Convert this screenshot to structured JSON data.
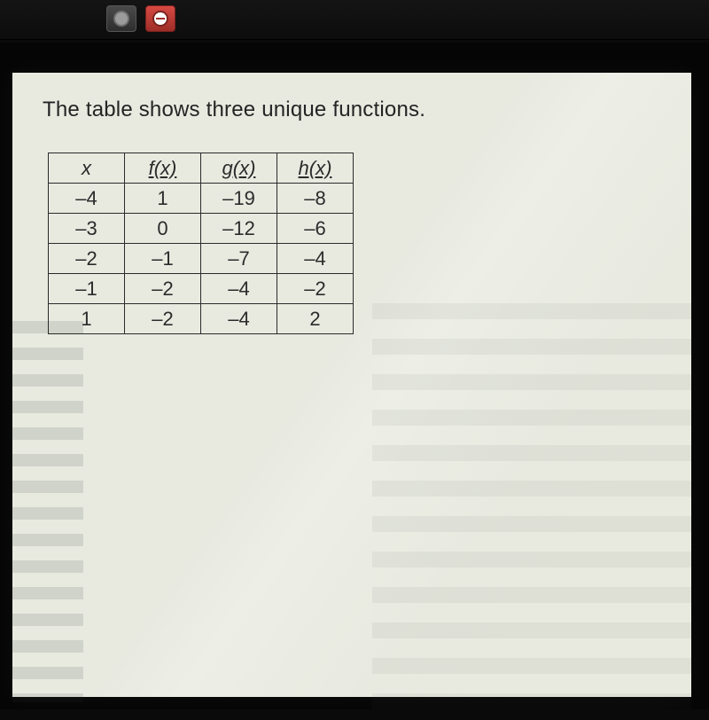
{
  "title": "The table shows three unique functions.",
  "chart_data": {
    "type": "table",
    "columns": [
      "x",
      "f(x)",
      "g(x)",
      "h(x)"
    ],
    "rows": [
      [
        -4,
        1,
        -19,
        -8
      ],
      [
        -3,
        0,
        -12,
        -6
      ],
      [
        -2,
        -1,
        -7,
        -4
      ],
      [
        -1,
        -2,
        -4,
        -2
      ],
      [
        1,
        -2,
        -4,
        2
      ]
    ]
  }
}
